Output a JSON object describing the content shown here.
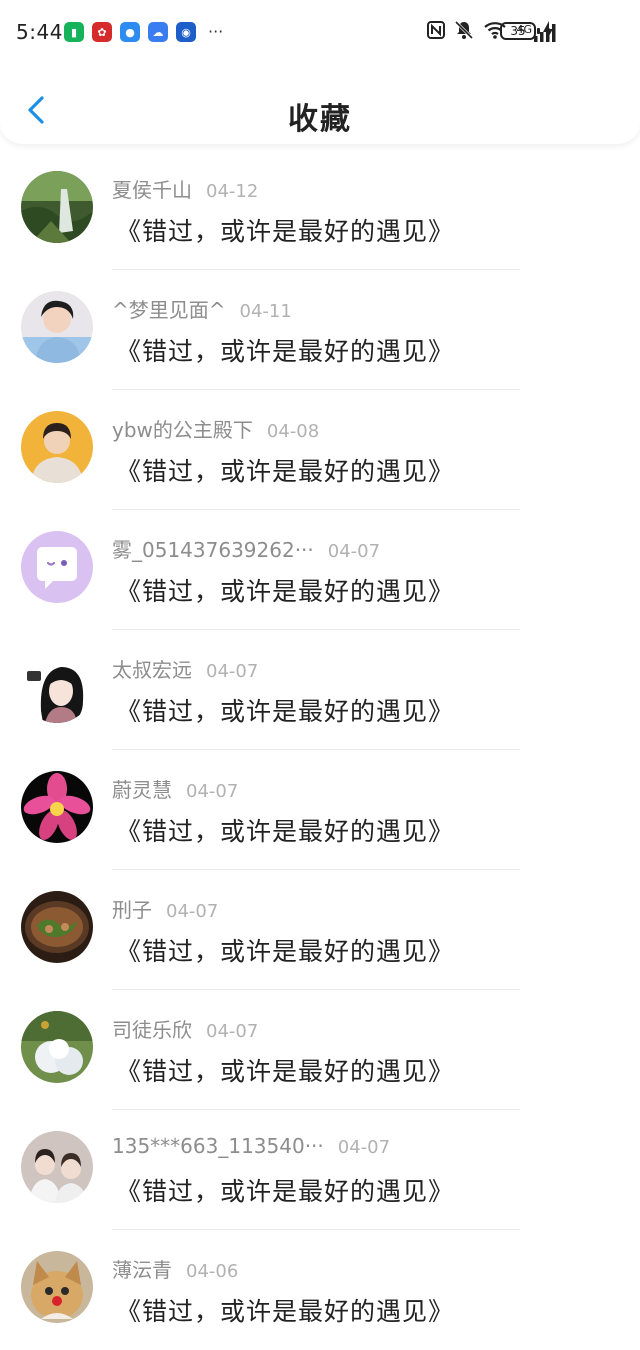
{
  "status_bar": {
    "time": "5:44",
    "more": "···",
    "battery": "35",
    "network": "4G",
    "apps": [
      {
        "icon": "green-app-icon",
        "color": "#16b35a"
      },
      {
        "icon": "huawei-icon",
        "color": "#d62b2b"
      },
      {
        "icon": "message-icon",
        "color": "#2e8cf0"
      },
      {
        "icon": "cloud-icon",
        "color": "#3a7df0"
      },
      {
        "icon": "bank-icon",
        "color": "#1d5ec9"
      }
    ]
  },
  "header": {
    "title": "收藏",
    "back_icon": "chevron-left-icon"
  },
  "items": [
    {
      "user": "夏侯千山",
      "date": "04-12",
      "text": "《错过，或许是最好的遇见》"
    },
    {
      "user": "^梦里见面^",
      "date": "04-11",
      "text": "《错过，或许是最好的遇见》"
    },
    {
      "user": "ybw的公主殿下",
      "date": "04-08",
      "text": "《错过，或许是最好的遇见》"
    },
    {
      "user": "雾_051437639262···",
      "date": "04-07",
      "text": "《错过，或许是最好的遇见》"
    },
    {
      "user": "太叔宏远",
      "date": "04-07",
      "text": "《错过，或许是最好的遇见》"
    },
    {
      "user": "蔚灵慧",
      "date": "04-07",
      "text": "《错过，或许是最好的遇见》"
    },
    {
      "user": "刑子",
      "date": "04-07",
      "text": "《错过，或许是最好的遇见》"
    },
    {
      "user": "司徒乐欣",
      "date": "04-07",
      "text": "《错过，或许是最好的遇见》"
    },
    {
      "user": "135***663_113540···",
      "date": "04-07",
      "text": "《错过，或许是最好的遇见》"
    },
    {
      "user": "薄沄青",
      "date": "04-06",
      "text": "《错过，或许是最好的遇见》"
    }
  ]
}
